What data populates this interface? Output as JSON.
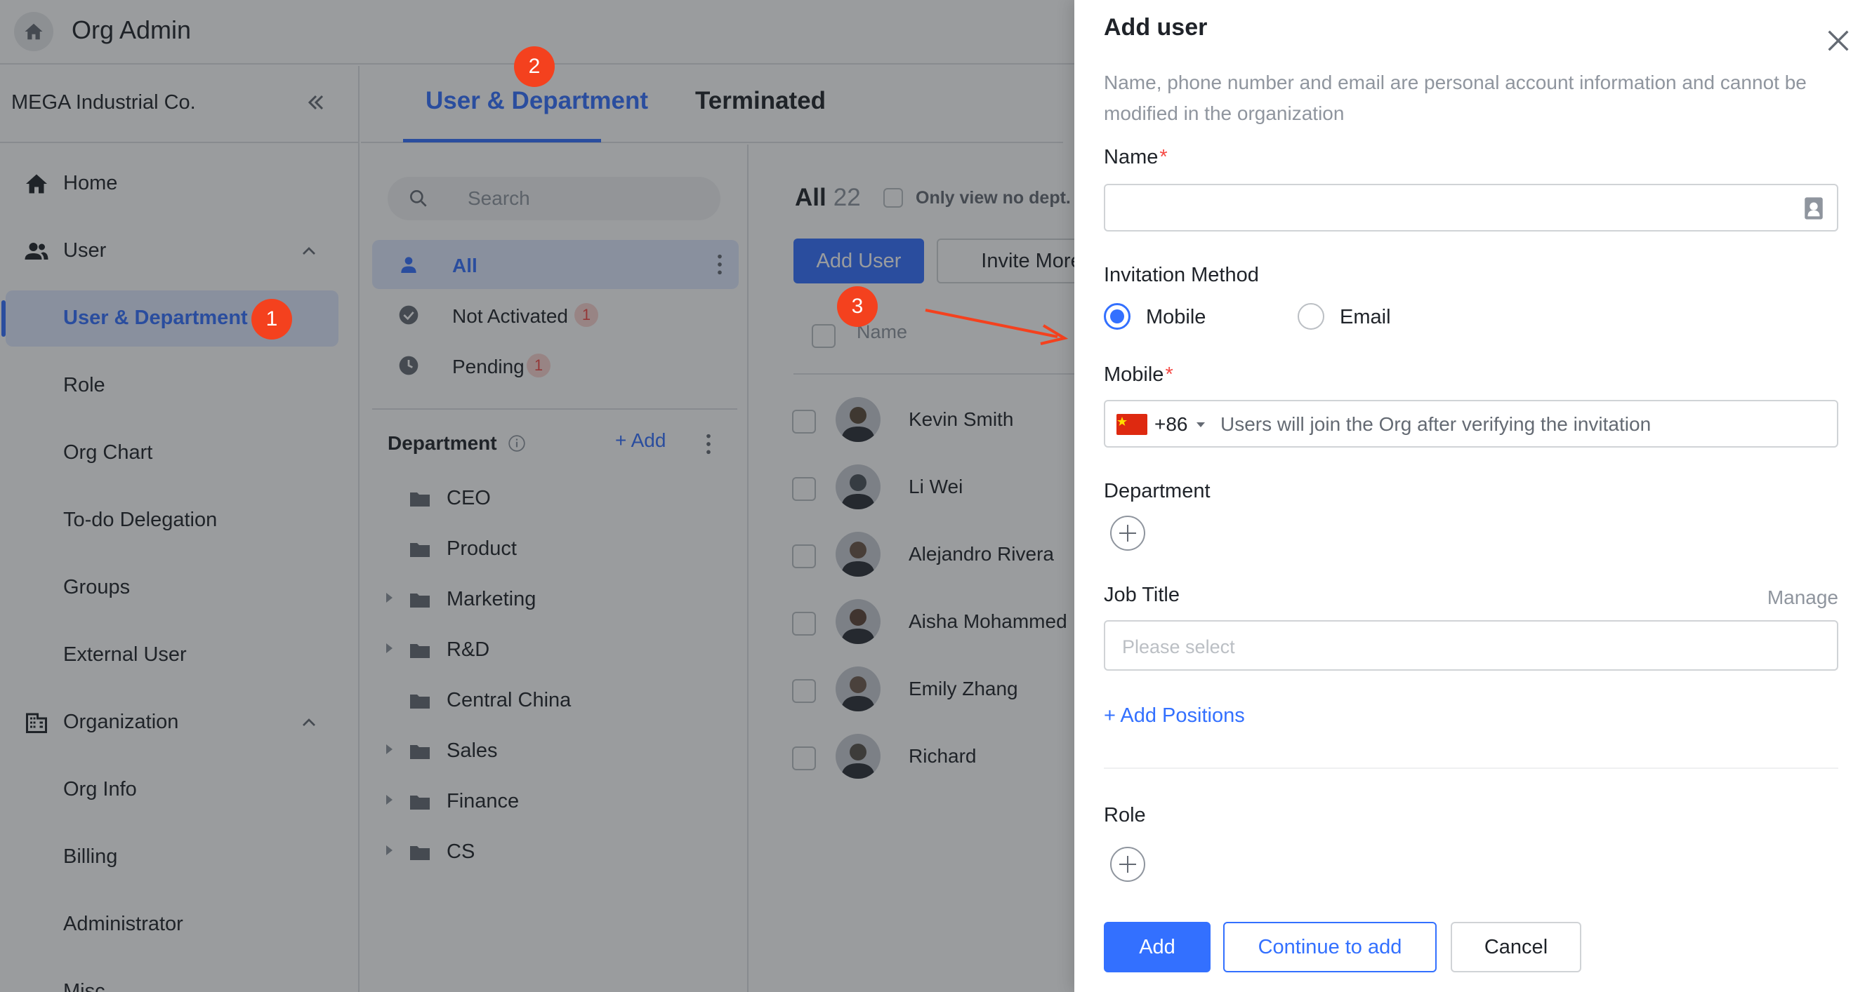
{
  "app": {
    "title": "Org Admin"
  },
  "sidebar": {
    "org_name": "MEGA Industrial Co.",
    "items": [
      {
        "label": "Home",
        "icon": "home-icon"
      },
      {
        "label": "User",
        "icon": "users-icon",
        "expanded": true
      },
      {
        "label": "User & Department",
        "active": true
      },
      {
        "label": "Role"
      },
      {
        "label": "Org Chart"
      },
      {
        "label": "To-do Delegation"
      },
      {
        "label": "Groups"
      },
      {
        "label": "External User"
      },
      {
        "label": "Organization",
        "icon": "building-icon",
        "expanded": true
      },
      {
        "label": "Org Info"
      },
      {
        "label": "Billing"
      },
      {
        "label": "Administrator"
      },
      {
        "label": "Misc"
      }
    ]
  },
  "tabs": [
    {
      "label": "User & Department",
      "active": true
    },
    {
      "label": "Terminated"
    }
  ],
  "dept_panel": {
    "search_placeholder": "Search",
    "filters": [
      {
        "label": "All",
        "active": true
      },
      {
        "label": "Not Activated",
        "badge": "1"
      },
      {
        "label": "Pending",
        "badge": "1"
      }
    ],
    "department_heading": "Department",
    "add_label": "+ Add",
    "departments": [
      {
        "label": "CEO",
        "expandable": false
      },
      {
        "label": "Product",
        "expandable": false
      },
      {
        "label": "Marketing",
        "expandable": true
      },
      {
        "label": "R&D",
        "expandable": true
      },
      {
        "label": "Central China",
        "expandable": false
      },
      {
        "label": "Sales",
        "expandable": true
      },
      {
        "label": "Finance",
        "expandable": true
      },
      {
        "label": "CS",
        "expandable": true
      }
    ]
  },
  "user_list": {
    "all_label": "All",
    "count": "22",
    "only_no_dept_label": "Only view no dept.",
    "add_user_label": "Add User",
    "invite_more_label": "Invite More",
    "name_column": "Name",
    "users": [
      {
        "name": "Kevin Smith",
        "avatar_color": "#5a4a3a"
      },
      {
        "name": "Li Wei",
        "avatar_color": "#4a5058"
      },
      {
        "name": "Alejandro Rivera",
        "avatar_color": "#6b5446"
      },
      {
        "name": "Aisha Mohammed",
        "avatar_color": "#5b4236"
      },
      {
        "name": "Emily Zhang",
        "avatar_color": "#6d5a4e"
      },
      {
        "name": "Richard",
        "avatar_color": "#56504a"
      }
    ]
  },
  "annotations": {
    "step1": "1",
    "step2": "2",
    "step3": "3",
    "arrow_color": "#f4411e"
  },
  "drawer": {
    "title": "Add user",
    "hint": "Name, phone number and email are personal account information and cannot be modified in the organization",
    "name_label": "Name",
    "required_mark": "*",
    "invitation_label": "Invitation Method",
    "methods": [
      {
        "label": "Mobile",
        "selected": true
      },
      {
        "label": "Email",
        "selected": false
      }
    ],
    "mobile_label": "Mobile",
    "country_code": "+86",
    "mobile_placeholder": "Users will join the Org after verifying the invitation",
    "department_label": "Department",
    "job_title_label": "Job Title",
    "manage_label": "Manage",
    "job_title_placeholder": "Please select",
    "add_positions_label": "+ Add Positions",
    "role_label": "Role",
    "add_button": "Add",
    "continue_button": "Continue to add",
    "cancel_button": "Cancel"
  },
  "colors": {
    "accent": "#3370ff",
    "badge": "#f4411e",
    "required": "#f54a45"
  }
}
